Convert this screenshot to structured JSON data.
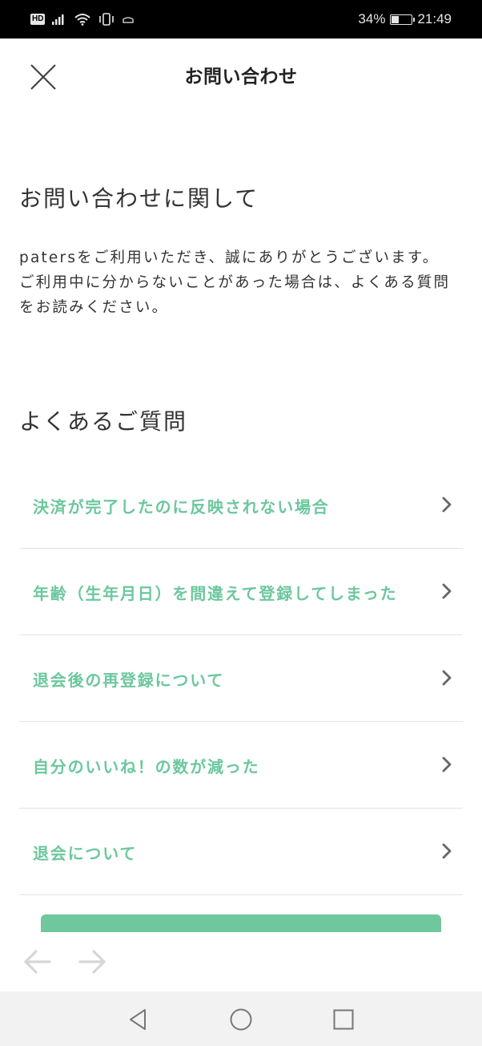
{
  "status_bar": {
    "hd": "HD",
    "battery_percent": "34%",
    "battery_level": 0.34,
    "time": "21:49",
    "icons": [
      "signal-icon",
      "wifi-icon",
      "vibrate-icon",
      "notification-icon",
      "battery-icon"
    ]
  },
  "header": {
    "title": "お問い合わせ",
    "close_icon": "close-icon"
  },
  "about": {
    "title": "お問い合わせに関して",
    "paragraphs": [
      "patersをご利用いただき、誠にありがとうございます。",
      "ご利用中に分からないことがあった場合は、よくある質問をお読みください。"
    ]
  },
  "faq": {
    "title": "よくあるご質問",
    "items": [
      {
        "label": "決済が完了したのに反映されない場合"
      },
      {
        "label": "年齢（生年月日）を間違えて登録してしまった"
      },
      {
        "label": "退会後の再登録について"
      },
      {
        "label": "自分のいいね！の数が減った"
      },
      {
        "label": "退会について"
      }
    ]
  },
  "colors": {
    "accent": "#6cc79e",
    "button": "#6fc79d",
    "text": "#333333",
    "divider": "#e2e2e2",
    "status_bar": "#000000",
    "system_nav": "#f2f2f2",
    "browser_arrow": "#d6d6d6"
  },
  "browser_nav": {
    "back_icon": "arrow-left-icon",
    "forward_icon": "arrow-right-icon"
  },
  "system_nav": {
    "back_icon": "triangle-back-icon",
    "home_icon": "circle-home-icon",
    "recent_icon": "square-recent-icon"
  }
}
